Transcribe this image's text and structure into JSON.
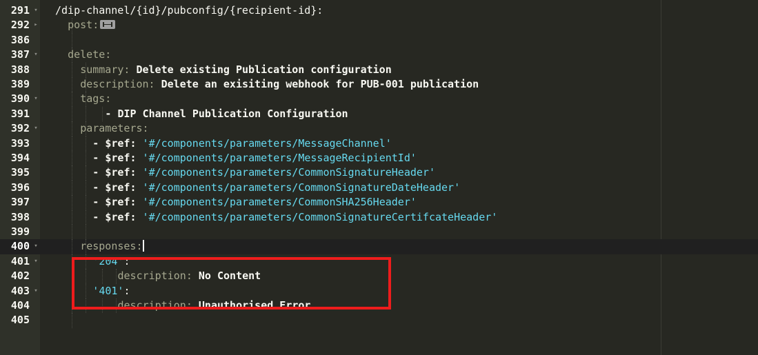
{
  "colors": {
    "background": "#272822",
    "gutter": "#2f3129",
    "key": "#a6a88f",
    "string": "#66d9ef",
    "text": "#f8f8f2",
    "annotation_box": "#ee1c1c"
  },
  "icons": {
    "fold_open": "▾",
    "fold_closed": "▸"
  },
  "lines": [
    {
      "num": "291",
      "fold": "open",
      "tokens": [
        {
          "t": "/dip-channel/{id}/pubconfig/{recipient-id}:",
          "c": "plain"
        }
      ]
    },
    {
      "num": "292",
      "fold": "closed",
      "tokens": [
        {
          "t": "post:",
          "c": "key"
        }
      ],
      "collapsed": true
    },
    {
      "num": "386",
      "fold": "",
      "tokens": []
    },
    {
      "num": "387",
      "fold": "open",
      "tokens": [
        {
          "t": "delete:",
          "c": "key"
        }
      ]
    },
    {
      "num": "388",
      "fold": "",
      "tokens": [
        {
          "t": "summary:",
          "c": "key"
        },
        {
          "t": " Delete existing Publication configuration",
          "c": "bold"
        }
      ]
    },
    {
      "num": "389",
      "fold": "",
      "tokens": [
        {
          "t": "description:",
          "c": "key"
        },
        {
          "t": " Delete an exisiting webhook for PUB-001 publication",
          "c": "bold"
        }
      ]
    },
    {
      "num": "390",
      "fold": "open",
      "tokens": [
        {
          "t": "tags:",
          "c": "key"
        }
      ]
    },
    {
      "num": "391",
      "fold": "",
      "tokens": [
        {
          "t": "- DIP Channel Publication Configuration",
          "c": "bold"
        }
      ]
    },
    {
      "num": "392",
      "fold": "open",
      "tokens": [
        {
          "t": "parameters:",
          "c": "key"
        }
      ]
    },
    {
      "num": "393",
      "fold": "",
      "tokens": [
        {
          "t": "- ",
          "c": "bold"
        },
        {
          "t": "$ref:",
          "c": "ref"
        },
        {
          "t": " '#/components/parameters/MessageChannel'",
          "c": "str"
        }
      ]
    },
    {
      "num": "394",
      "fold": "",
      "tokens": [
        {
          "t": "- ",
          "c": "bold"
        },
        {
          "t": "$ref:",
          "c": "ref"
        },
        {
          "t": " '#/components/parameters/MessageRecipientId'",
          "c": "str"
        }
      ]
    },
    {
      "num": "395",
      "fold": "",
      "tokens": [
        {
          "t": "- ",
          "c": "bold"
        },
        {
          "t": "$ref:",
          "c": "ref"
        },
        {
          "t": " '#/components/parameters/CommonSignatureHeader'",
          "c": "str"
        }
      ]
    },
    {
      "num": "396",
      "fold": "",
      "tokens": [
        {
          "t": "- ",
          "c": "bold"
        },
        {
          "t": "$ref:",
          "c": "ref"
        },
        {
          "t": " '#/components/parameters/CommonSignatureDateHeader'",
          "c": "str"
        }
      ]
    },
    {
      "num": "397",
      "fold": "",
      "tokens": [
        {
          "t": "- ",
          "c": "bold"
        },
        {
          "t": "$ref:",
          "c": "ref"
        },
        {
          "t": " '#/components/parameters/CommonSHA256Header'",
          "c": "str"
        }
      ]
    },
    {
      "num": "398",
      "fold": "",
      "tokens": [
        {
          "t": "- ",
          "c": "bold"
        },
        {
          "t": "$ref:",
          "c": "ref"
        },
        {
          "t": " '#/components/parameters/CommonSignatureCertifcateHeader'",
          "c": "str"
        }
      ]
    },
    {
      "num": "399",
      "fold": "",
      "tokens": []
    },
    {
      "num": "400",
      "fold": "open",
      "tokens": [
        {
          "t": "responses:",
          "c": "key"
        }
      ],
      "active": true,
      "caret": true
    },
    {
      "num": "401",
      "fold": "open",
      "tokens": [
        {
          "t": "'204'",
          "c": "str"
        },
        {
          "t": ":",
          "c": "plain"
        }
      ]
    },
    {
      "num": "402",
      "fold": "",
      "tokens": [
        {
          "t": "description:",
          "c": "key"
        },
        {
          "t": " No Content",
          "c": "bold"
        }
      ]
    },
    {
      "num": "403",
      "fold": "open",
      "tokens": [
        {
          "t": "'401'",
          "c": "str"
        },
        {
          "t": ":",
          "c": "plain"
        }
      ]
    },
    {
      "num": "404",
      "fold": "",
      "tokens": [
        {
          "t": "description:",
          "c": "key"
        },
        {
          "t": " Unauthorised Error",
          "c": "bold"
        }
      ]
    },
    {
      "num": "405",
      "fold": "",
      "tokens": []
    }
  ]
}
